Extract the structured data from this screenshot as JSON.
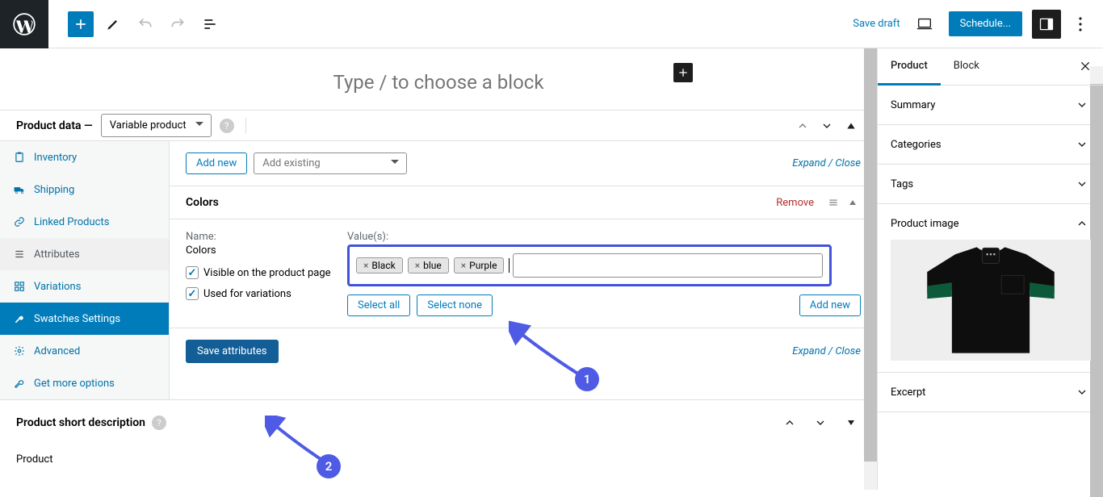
{
  "toolbar": {
    "save_draft": "Save draft",
    "schedule": "Schedule..."
  },
  "editor": {
    "placeholder": "Type / to choose a block"
  },
  "product_data": {
    "label": "Product data —",
    "type_selected": "Variable product",
    "nav": {
      "inventory": "Inventory",
      "shipping": "Shipping",
      "linked": "Linked Products",
      "attributes": "Attributes",
      "variations": "Variations",
      "swatches": "Swatches Settings",
      "advanced": "Advanced",
      "more": "Get more options"
    }
  },
  "attributes": {
    "add_new": "Add new",
    "add_existing_placeholder": "Add existing",
    "expand_close": "Expand / Close",
    "attr_title": "Colors",
    "remove": "Remove",
    "name_label": "Name:",
    "name_value": "Colors",
    "values_label": "Value(s):",
    "visible_label": "Visible on the product page",
    "used_label": "Used for variations",
    "chips": [
      "Black",
      "blue",
      "Purple"
    ],
    "select_all": "Select all",
    "select_none": "Select none",
    "add_new_value": "Add new",
    "save": "Save attributes"
  },
  "callouts": {
    "one": "1",
    "two": "2"
  },
  "short_desc": {
    "title": "Product short description",
    "body": "Product"
  },
  "right_panel": {
    "tabs": {
      "product": "Product",
      "block": "Block"
    },
    "sections": {
      "summary": "Summary",
      "categories": "Categories",
      "tags": "Tags",
      "product_image": "Product image",
      "excerpt": "Excerpt"
    }
  }
}
